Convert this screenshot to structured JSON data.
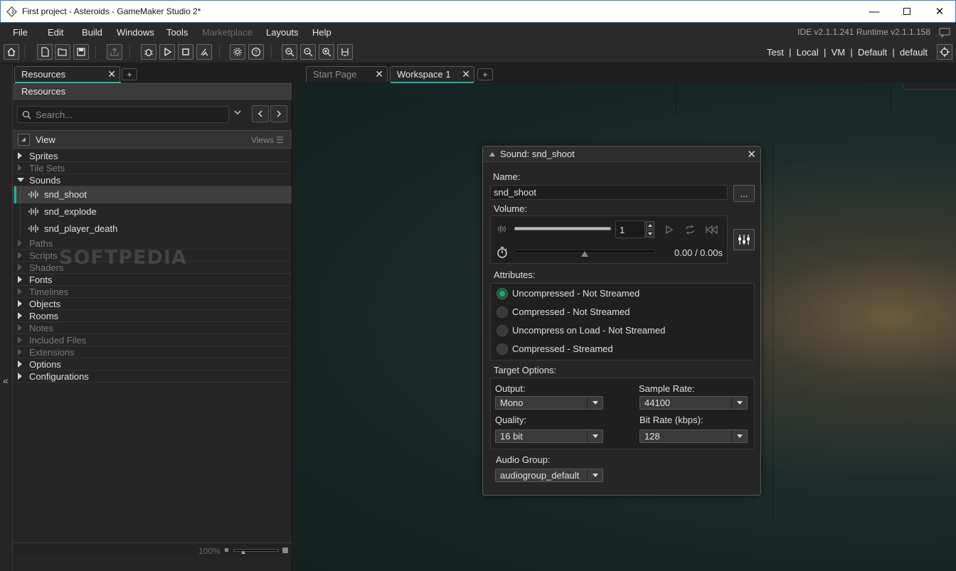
{
  "window": {
    "title": "First project - Asteroids - GameMaker Studio 2*"
  },
  "menu": {
    "items": [
      "File",
      "Edit",
      "Build",
      "Windows",
      "Tools",
      "Marketplace",
      "Layouts",
      "Help"
    ],
    "version": "IDE v2.1.1.241 Runtime v2.1.1.158"
  },
  "toolbar": {
    "targets": "Test  |  Local  |  VM  |  Default  |  default",
    "icons": [
      "home-icon",
      "new-file-icon",
      "open-folder-icon",
      "save-icon",
      "export-icon",
      "debug-icon",
      "play-icon",
      "stop-icon",
      "clean-icon",
      "settings-icon",
      "help-icon",
      "zoom-out-icon",
      "zoom-reset-icon",
      "zoom-in-icon",
      "gamepad-icon",
      "target-icon"
    ]
  },
  "resources_panel": {
    "tab_label": "Resources",
    "header": "Resources",
    "search_placeholder": "Search...",
    "view_label": "View",
    "views_label": "Views",
    "tree": [
      {
        "label": "Sprites",
        "dim": false
      },
      {
        "label": "Tile Sets",
        "dim": true
      },
      {
        "label": "Sounds",
        "dim": false,
        "open": true,
        "children": [
          "snd_shoot",
          "snd_explode",
          "snd_player_death"
        ]
      },
      {
        "label": "Paths",
        "dim": true
      },
      {
        "label": "Scripts",
        "dim": true
      },
      {
        "label": "Shaders",
        "dim": true
      },
      {
        "label": "Fonts",
        "dim": false
      },
      {
        "label": "Timelines",
        "dim": true
      },
      {
        "label": "Objects",
        "dim": false
      },
      {
        "label": "Rooms",
        "dim": false
      },
      {
        "label": "Notes",
        "dim": true
      },
      {
        "label": "Included Files",
        "dim": true
      },
      {
        "label": "Extensions",
        "dim": true
      },
      {
        "label": "Options",
        "dim": false
      },
      {
        "label": "Configurations",
        "dim": false
      }
    ],
    "zoom": "100%",
    "watermark": "SOFTPEDIA"
  },
  "workspace": {
    "tabs": [
      "Start Page",
      "Workspace 1"
    ],
    "active_tab": "Workspace 1"
  },
  "sound_editor": {
    "title": "Sound: snd_shoot",
    "name_label": "Name:",
    "name_value": "snd_shoot",
    "browse_label": "...",
    "volume_label": "Volume:",
    "volume_value": "1",
    "volume_level": 1.0,
    "time": "0.00 / 0.00s",
    "attributes_label": "Attributes:",
    "attributes": [
      "Uncompressed - Not Streamed",
      "Compressed - Not Streamed",
      "Uncompress on Load - Not Streamed",
      "Compressed - Streamed"
    ],
    "selected_attribute": "Uncompressed - Not Streamed",
    "target_options_label": "Target Options:",
    "output_label": "Output:",
    "output_value": "Mono",
    "sample_rate_label": "Sample Rate:",
    "sample_rate_value": "44100",
    "quality_label": "Quality:",
    "quality_value": "16 bit",
    "bit_rate_label": "Bit Rate (kbps):",
    "bit_rate_value": "128",
    "audio_group_label": "Audio Group:",
    "audio_group_value": "audiogroup_default"
  },
  "colors": {
    "accent": "#20b0a0",
    "radio_on": "#1faa6a"
  }
}
